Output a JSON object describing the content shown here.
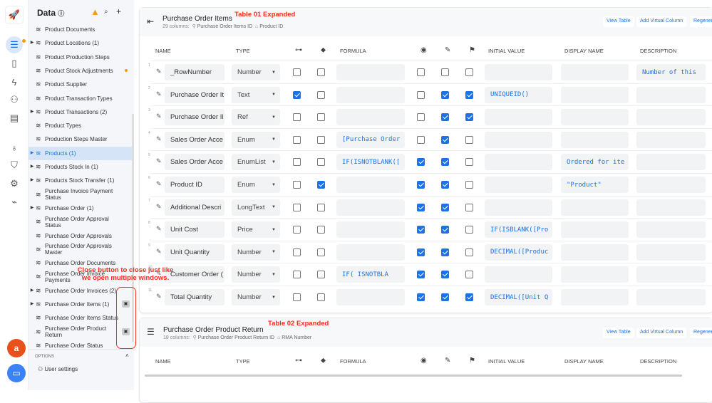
{
  "rail": {
    "icons": [
      "app-logo-icon",
      "data-icon",
      "device-icon",
      "automation-icon",
      "bot-icon",
      "chat-icon",
      "lightbulb-icon",
      "security-icon",
      "settings-icon",
      "monitor-icon"
    ]
  },
  "sidebar": {
    "title": "Data",
    "items": [
      {
        "label": "Product Documents",
        "expandable": false
      },
      {
        "label": "Product Locations (1)",
        "expandable": true
      },
      {
        "label": "Product Production Steps",
        "expandable": false
      },
      {
        "label": "Product Stock Adjustments",
        "expandable": false,
        "dot": true
      },
      {
        "label": "Product Supplier",
        "expandable": false
      },
      {
        "label": "Product Transaction Types",
        "expandable": false
      },
      {
        "label": "Product Transactions (2)",
        "expandable": true
      },
      {
        "label": "Product Types",
        "expandable": false
      },
      {
        "label": "Production Steps Master",
        "expandable": false
      },
      {
        "label": "Products (1)",
        "expandable": true,
        "selected": true
      },
      {
        "label": "Products Stock In (1)",
        "expandable": true
      },
      {
        "label": "Products Stock Transfer (1)",
        "expandable": true
      },
      {
        "label": "Purchase Invoice Payment Status",
        "expandable": false
      },
      {
        "label": "Purchase Order (1)",
        "expandable": true
      },
      {
        "label": "Purchase Order Approval Status",
        "expandable": false
      },
      {
        "label": "Purchase Order Approvals",
        "expandable": false
      },
      {
        "label": "Purchase Order Approvals Master",
        "expandable": false
      },
      {
        "label": "Purchase Order Documents",
        "expandable": false
      },
      {
        "label": "Purchase Order Invoice Payments",
        "expandable": false
      },
      {
        "label": "Purchase Order Invoices (2)",
        "expandable": true
      },
      {
        "label": "Purchase Order Items (1)",
        "expandable": true,
        "close": true
      },
      {
        "label": "Purchase Order Items Status",
        "expandable": false
      },
      {
        "label": "Purchase Order Product Return",
        "expandable": false,
        "close": true
      },
      {
        "label": "Purchase Order Status",
        "expandable": false
      }
    ],
    "options_label": "OPTIONS",
    "user_settings": "User settings"
  },
  "annotations": {
    "close": "Close button to close just like we open multiple windows.",
    "table1": "Table 01 Expanded",
    "table2": "Table 02 Expanded"
  },
  "columns": {
    "name": "NAME",
    "type": "TYPE",
    "formula": "FORMULA",
    "initial": "INITIAL VALUE",
    "display": "DISPLAY NAME",
    "description": "DESCRIPTION"
  },
  "table1": {
    "title": "Purchase Order Items",
    "count": "29 columns:",
    "key": "Purchase Order Items ID",
    "label": "Product ID",
    "buttons": [
      "View Table",
      "Add Virtual Column",
      "Regenera"
    ],
    "rows": [
      {
        "n": "1",
        "name": "_RowNumber",
        "type": "Number",
        "key": false,
        "label": false,
        "formula": "",
        "show": false,
        "edit": false,
        "req": false,
        "initial": "",
        "display": "",
        "desc": "Number of this"
      },
      {
        "n": "2",
        "name": "Purchase Order It",
        "type": "Text",
        "key": true,
        "label": false,
        "formula": "",
        "show": false,
        "edit": true,
        "req": true,
        "initial": "UNIQUEID()",
        "display": "",
        "desc": ""
      },
      {
        "n": "3",
        "name": "Purchase Order Il",
        "type": "Ref",
        "key": false,
        "label": false,
        "formula": "",
        "show": false,
        "edit": true,
        "req": true,
        "initial": "",
        "display": "",
        "desc": ""
      },
      {
        "n": "4",
        "name": "Sales Order Acce",
        "type": "Enum",
        "key": false,
        "label": false,
        "formula": "[Purchase Order",
        "show": false,
        "edit": true,
        "req": false,
        "initial": "",
        "display": "",
        "desc": ""
      },
      {
        "n": "5",
        "name": "Sales Order Acce",
        "type": "EnumList",
        "key": false,
        "label": false,
        "formula": "IF(ISNOTBLANK([",
        "show": true,
        "edit": true,
        "req": false,
        "initial": "",
        "display": "Ordered for ite",
        "desc": ""
      },
      {
        "n": "6",
        "name": "Product ID",
        "type": "Enum",
        "key": false,
        "label": true,
        "formula": "",
        "show": true,
        "edit": true,
        "req": false,
        "initial": "",
        "display": "\"Product\"",
        "desc": ""
      },
      {
        "n": "7",
        "name": "Additional Descri",
        "type": "LongText",
        "key": false,
        "label": false,
        "formula": "",
        "show": true,
        "edit": true,
        "req": false,
        "initial": "",
        "display": "",
        "desc": ""
      },
      {
        "n": "8",
        "name": "Unit Cost",
        "type": "Price",
        "key": false,
        "label": false,
        "formula": "",
        "show": true,
        "edit": true,
        "req": false,
        "initial": "IF(ISBLANK([Pro",
        "display": "",
        "desc": ""
      },
      {
        "n": "9",
        "name": "Unit Quantity",
        "type": "Number",
        "key": false,
        "label": false,
        "formula": "",
        "show": true,
        "edit": true,
        "req": false,
        "initial": "DECIMAL([Produc",
        "display": "",
        "desc": ""
      },
      {
        "n": "10",
        "name": "Customer Order (",
        "type": "Number",
        "key": false,
        "label": false,
        "formula": "IF(    ISNOTBLA",
        "show": true,
        "edit": true,
        "req": false,
        "initial": "",
        "display": "",
        "desc": ""
      },
      {
        "n": "11",
        "name": "Total Quantity",
        "type": "Number",
        "key": false,
        "label": false,
        "formula": "",
        "show": true,
        "edit": true,
        "req": true,
        "initial": "DECIMAL([Unit Q",
        "display": "",
        "desc": ""
      }
    ]
  },
  "table2": {
    "title": "Purchase Order Product Return",
    "count": "18 columns:",
    "key": "Purchase Order Product Return ID",
    "label": "RMA Number",
    "buttons": [
      "View Table",
      "Add Virtual Column",
      "Regenera"
    ]
  },
  "colors": {
    "accent": "#1a73e8",
    "annotation": "#ff2a1a",
    "warning": "#f59e0b",
    "launcher": "#e8501c"
  }
}
